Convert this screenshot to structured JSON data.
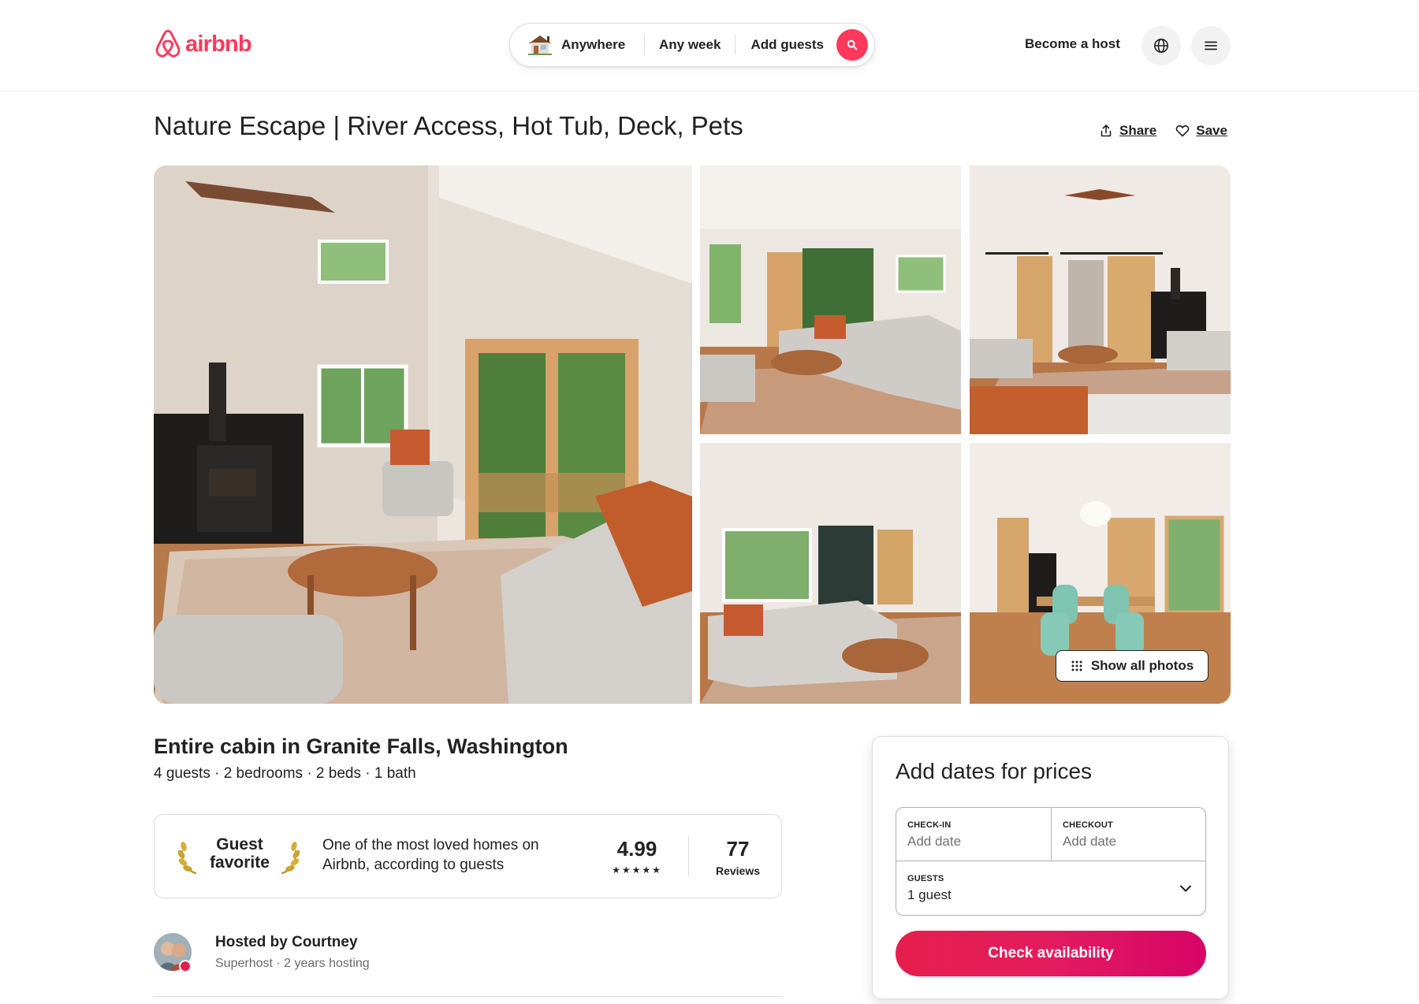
{
  "header": {
    "logo_text": "airbnb",
    "search": {
      "where": "Anywhere",
      "week": "Any week",
      "guests": "Add guests"
    },
    "become_host": "Become a host"
  },
  "listing": {
    "title": "Nature Escape | River Access, Hot Tub, Deck, Pets",
    "share_label": "Share",
    "save_label": "Save",
    "show_all_photos": "Show all photos",
    "subtitle": "Entire cabin in Granite Falls, Washington",
    "facts": "4 guests · 2 bedrooms · 2 beds · 1 bath"
  },
  "guest_favorite": {
    "label_line1": "Guest",
    "label_line2": "favorite",
    "description": "One of the most loved homes on Airbnb, according to guests",
    "rating": "4.99",
    "stars": "★★★★★",
    "reviews_count": "77",
    "reviews_label": "Reviews"
  },
  "host": {
    "hosted_by": "Hosted by Courtney",
    "meta": "Superhost · 2 years hosting"
  },
  "booking": {
    "title": "Add dates for prices",
    "checkin_label": "CHECK-IN",
    "checkin_value": "Add date",
    "checkout_label": "CHECKOUT",
    "checkout_value": "Add date",
    "guests_label": "GUESTS",
    "guests_value": "1 guest",
    "button_label": "Check availability"
  },
  "colors": {
    "brand": "#ff385c",
    "cta_start": "#e61e4d",
    "cta_end": "#d70466",
    "text": "#222222",
    "muted": "#6a6a6a",
    "border": "#dddddd"
  }
}
